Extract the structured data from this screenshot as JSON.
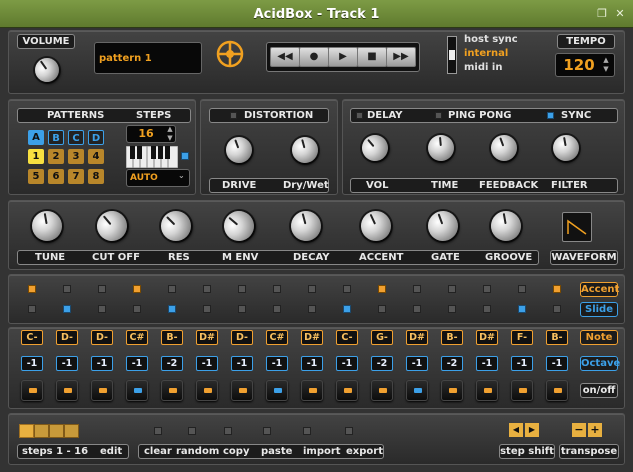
{
  "window": {
    "title": "AcidBox - Track 1",
    "restore_glyph": "❐",
    "close_glyph": "✕"
  },
  "top": {
    "volume_label": "VOLUME",
    "pattern_name": "pattern 1",
    "logo": "acidbox-logo-icon",
    "transport": {
      "rewind": "◀◀",
      "record": "●",
      "play": "▶",
      "stop": "■",
      "forward": "▶▶"
    },
    "sync": {
      "options": [
        "host sync",
        "internal",
        "midi in"
      ],
      "selected": "internal"
    },
    "tempo_label": "TEMPO",
    "tempo_value": "120"
  },
  "patterns": {
    "label": "PATTERNS",
    "steps_label": "STEPS",
    "letters": [
      "A",
      "B",
      "C",
      "D"
    ],
    "selected_letter": "A",
    "numbers": [
      "1",
      "2",
      "3",
      "4",
      "5",
      "6",
      "7",
      "8"
    ],
    "selected_number": "1",
    "steps_value": "16",
    "mode": "AUTO"
  },
  "distortion": {
    "label": "DISTORTION",
    "knobs": [
      "DRIVE",
      "Dry/Wet"
    ]
  },
  "delay": {
    "delay_label": "DELAY",
    "pingpong_label": "PING PONG",
    "sync_label": "SYNC",
    "knobs": [
      "VOL",
      "TIME",
      "FEEDBACK",
      "FILTER"
    ]
  },
  "synth": {
    "knobs": [
      "TUNE",
      "CUT OFF",
      "RES",
      "M ENV",
      "DECAY",
      "ACCENT",
      "GATE",
      "GROOVE"
    ],
    "waveform_label": "WAVEFORM"
  },
  "sequencer": {
    "accent_label": "Accent",
    "slide_label": "Slide",
    "note_label": "Note",
    "octave_label": "Octave",
    "onoff_label": "on/off",
    "accent": [
      1,
      0,
      0,
      1,
      0,
      0,
      0,
      0,
      0,
      0,
      1,
      0,
      0,
      0,
      0,
      1
    ],
    "slide": [
      0,
      1,
      0,
      0,
      1,
      0,
      0,
      0,
      0,
      1,
      0,
      0,
      0,
      0,
      1,
      0
    ],
    "notes": [
      "C-",
      "D-",
      "D-",
      "C#",
      "B-",
      "D#",
      "D-",
      "C#",
      "D#",
      "C-",
      "G-",
      "D#",
      "B-",
      "D#",
      "F-",
      "B-"
    ],
    "octaves": [
      "-1",
      "-1",
      "-1",
      "-1",
      "-2",
      "-1",
      "-1",
      "-1",
      "-1",
      "-1",
      "-2",
      "-1",
      "-2",
      "-1",
      "-1",
      "-1"
    ],
    "gates": [
      "o",
      "o",
      "o",
      "b",
      "o",
      "o",
      "o",
      "b",
      "o",
      "o",
      "o",
      "b",
      "o",
      "o",
      "o",
      "o"
    ]
  },
  "footer": {
    "steps_range": "steps 1 - 16",
    "edit": "edit",
    "actions": [
      "clear",
      "random",
      "copy",
      "paste",
      "import",
      "export"
    ],
    "step_shift": "step shift",
    "transpose": "transpose",
    "left_arrow": "◀",
    "right_arrow": "▶",
    "minus": "−",
    "plus": "+"
  },
  "colors": {
    "accent": "#f0a030",
    "blue": "#3ca0e8",
    "titlebar": "#6e8b3a"
  }
}
